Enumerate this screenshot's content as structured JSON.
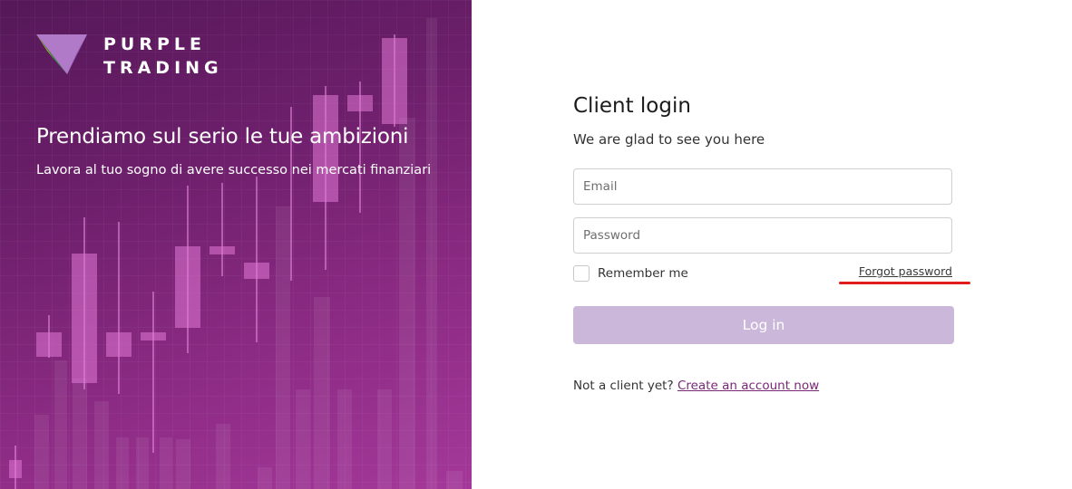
{
  "brand": {
    "line1": "PURPLE",
    "line2": "TRADING",
    "logo_icon": "purple-trading-logo-icon"
  },
  "hero": {
    "title": "Prendiamo sul serio le tue ambizioni",
    "subtitle": "Lavora al tuo sogno di avere successo nei mercati finanziari",
    "decoration": "candlestick-chart-background"
  },
  "login": {
    "title": "Client login",
    "subtitle": "We are glad to see you here",
    "email_placeholder": "Email",
    "password_placeholder": "Password",
    "remember_label": "Remember me",
    "forgot_label": "Forgot password",
    "submit_label": "Log in",
    "signup_prompt": "Not a client yet?",
    "signup_link": "Create an account now"
  },
  "colors": {
    "hero_gradient_start": "#551858",
    "hero_gradient_end": "#a4389a",
    "button_disabled": "#cbb7da",
    "link": "#7a2876",
    "annotation": "#e21c1c"
  }
}
